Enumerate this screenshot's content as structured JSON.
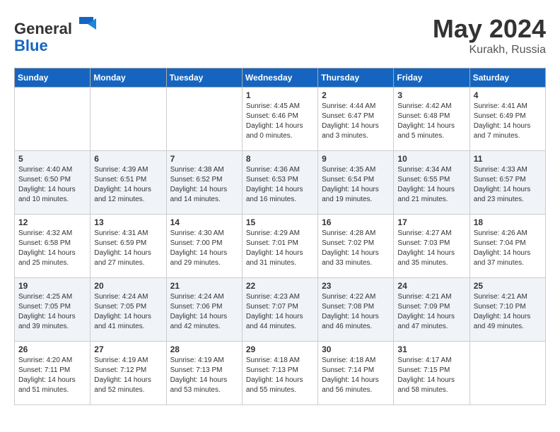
{
  "header": {
    "logo_general": "General",
    "logo_blue": "Blue",
    "month": "May 2024",
    "location": "Kurakh, Russia"
  },
  "weekdays": [
    "Sunday",
    "Monday",
    "Tuesday",
    "Wednesday",
    "Thursday",
    "Friday",
    "Saturday"
  ],
  "weeks": [
    [
      {
        "day": "",
        "info": ""
      },
      {
        "day": "",
        "info": ""
      },
      {
        "day": "",
        "info": ""
      },
      {
        "day": "1",
        "info": "Sunrise: 4:45 AM\nSunset: 6:46 PM\nDaylight: 14 hours\nand 0 minutes."
      },
      {
        "day": "2",
        "info": "Sunrise: 4:44 AM\nSunset: 6:47 PM\nDaylight: 14 hours\nand 3 minutes."
      },
      {
        "day": "3",
        "info": "Sunrise: 4:42 AM\nSunset: 6:48 PM\nDaylight: 14 hours\nand 5 minutes."
      },
      {
        "day": "4",
        "info": "Sunrise: 4:41 AM\nSunset: 6:49 PM\nDaylight: 14 hours\nand 7 minutes."
      }
    ],
    [
      {
        "day": "5",
        "info": "Sunrise: 4:40 AM\nSunset: 6:50 PM\nDaylight: 14 hours\nand 10 minutes."
      },
      {
        "day": "6",
        "info": "Sunrise: 4:39 AM\nSunset: 6:51 PM\nDaylight: 14 hours\nand 12 minutes."
      },
      {
        "day": "7",
        "info": "Sunrise: 4:38 AM\nSunset: 6:52 PM\nDaylight: 14 hours\nand 14 minutes."
      },
      {
        "day": "8",
        "info": "Sunrise: 4:36 AM\nSunset: 6:53 PM\nDaylight: 14 hours\nand 16 minutes."
      },
      {
        "day": "9",
        "info": "Sunrise: 4:35 AM\nSunset: 6:54 PM\nDaylight: 14 hours\nand 19 minutes."
      },
      {
        "day": "10",
        "info": "Sunrise: 4:34 AM\nSunset: 6:55 PM\nDaylight: 14 hours\nand 21 minutes."
      },
      {
        "day": "11",
        "info": "Sunrise: 4:33 AM\nSunset: 6:57 PM\nDaylight: 14 hours\nand 23 minutes."
      }
    ],
    [
      {
        "day": "12",
        "info": "Sunrise: 4:32 AM\nSunset: 6:58 PM\nDaylight: 14 hours\nand 25 minutes."
      },
      {
        "day": "13",
        "info": "Sunrise: 4:31 AM\nSunset: 6:59 PM\nDaylight: 14 hours\nand 27 minutes."
      },
      {
        "day": "14",
        "info": "Sunrise: 4:30 AM\nSunset: 7:00 PM\nDaylight: 14 hours\nand 29 minutes."
      },
      {
        "day": "15",
        "info": "Sunrise: 4:29 AM\nSunset: 7:01 PM\nDaylight: 14 hours\nand 31 minutes."
      },
      {
        "day": "16",
        "info": "Sunrise: 4:28 AM\nSunset: 7:02 PM\nDaylight: 14 hours\nand 33 minutes."
      },
      {
        "day": "17",
        "info": "Sunrise: 4:27 AM\nSunset: 7:03 PM\nDaylight: 14 hours\nand 35 minutes."
      },
      {
        "day": "18",
        "info": "Sunrise: 4:26 AM\nSunset: 7:04 PM\nDaylight: 14 hours\nand 37 minutes."
      }
    ],
    [
      {
        "day": "19",
        "info": "Sunrise: 4:25 AM\nSunset: 7:05 PM\nDaylight: 14 hours\nand 39 minutes."
      },
      {
        "day": "20",
        "info": "Sunrise: 4:24 AM\nSunset: 7:05 PM\nDaylight: 14 hours\nand 41 minutes."
      },
      {
        "day": "21",
        "info": "Sunrise: 4:24 AM\nSunset: 7:06 PM\nDaylight: 14 hours\nand 42 minutes."
      },
      {
        "day": "22",
        "info": "Sunrise: 4:23 AM\nSunset: 7:07 PM\nDaylight: 14 hours\nand 44 minutes."
      },
      {
        "day": "23",
        "info": "Sunrise: 4:22 AM\nSunset: 7:08 PM\nDaylight: 14 hours\nand 46 minutes."
      },
      {
        "day": "24",
        "info": "Sunrise: 4:21 AM\nSunset: 7:09 PM\nDaylight: 14 hours\nand 47 minutes."
      },
      {
        "day": "25",
        "info": "Sunrise: 4:21 AM\nSunset: 7:10 PM\nDaylight: 14 hours\nand 49 minutes."
      }
    ],
    [
      {
        "day": "26",
        "info": "Sunrise: 4:20 AM\nSunset: 7:11 PM\nDaylight: 14 hours\nand 51 minutes."
      },
      {
        "day": "27",
        "info": "Sunrise: 4:19 AM\nSunset: 7:12 PM\nDaylight: 14 hours\nand 52 minutes."
      },
      {
        "day": "28",
        "info": "Sunrise: 4:19 AM\nSunset: 7:13 PM\nDaylight: 14 hours\nand 53 minutes."
      },
      {
        "day": "29",
        "info": "Sunrise: 4:18 AM\nSunset: 7:13 PM\nDaylight: 14 hours\nand 55 minutes."
      },
      {
        "day": "30",
        "info": "Sunrise: 4:18 AM\nSunset: 7:14 PM\nDaylight: 14 hours\nand 56 minutes."
      },
      {
        "day": "31",
        "info": "Sunrise: 4:17 AM\nSunset: 7:15 PM\nDaylight: 14 hours\nand 58 minutes."
      },
      {
        "day": "",
        "info": ""
      }
    ]
  ]
}
